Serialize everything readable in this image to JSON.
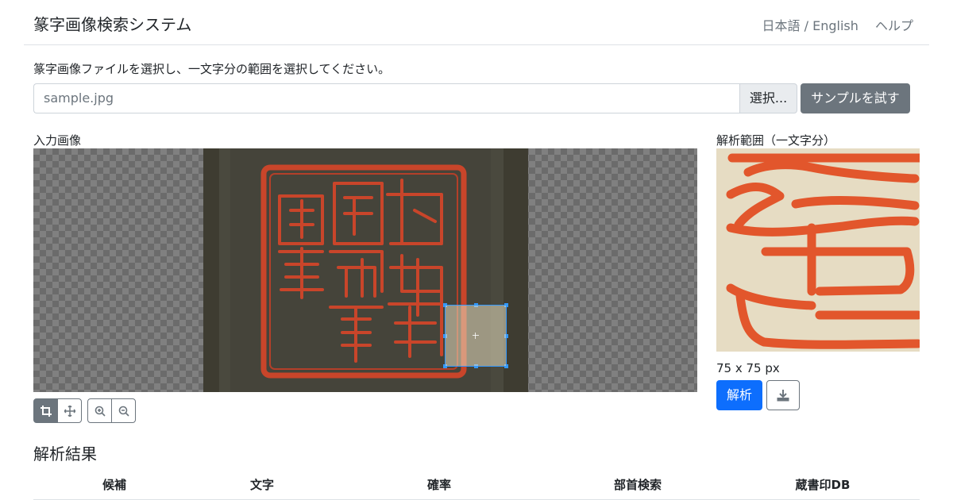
{
  "header": {
    "title": "篆字画像検索システム",
    "language": "日本語 / English",
    "help": "ヘルプ"
  },
  "upload": {
    "instruction": "篆字画像ファイルを選択し、一文字分の範囲を選択してください。",
    "file_value": "sample.jpg",
    "browse_label": "選択...",
    "sample_label": "サンプルを試す"
  },
  "input_image": {
    "label": "入力画像",
    "tools": [
      "crop-icon",
      "move-icon",
      "zoom-in-icon",
      "zoom-out-icon"
    ],
    "active_tool": "crop"
  },
  "analysis": {
    "label": "解析範囲（一文字分）",
    "size": "75 x 75 px",
    "analyze_label": "解析",
    "download_icon": "download-icon"
  },
  "results": {
    "title": "解析結果",
    "columns": [
      "候補",
      "文字",
      "確率",
      "部首検索",
      "蔵書印DB"
    ]
  },
  "colors": {
    "primary": "#0d6efd",
    "secondary": "#6c757d",
    "crop": "#3399ff",
    "seal_red": "#e0452a"
  }
}
